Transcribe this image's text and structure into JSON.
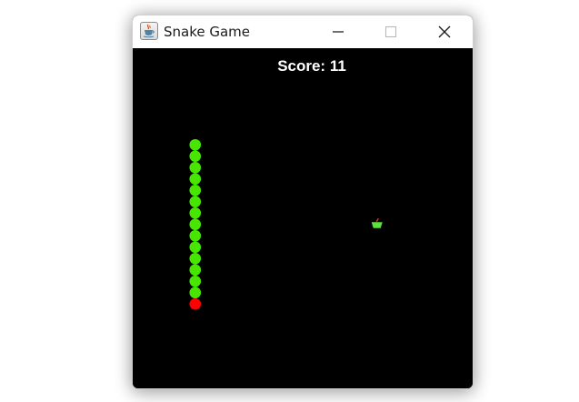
{
  "window": {
    "title": "Snake Game",
    "icon": "java-cup-icon",
    "controls": [
      "minimize-icon",
      "maximize-icon",
      "close-icon"
    ]
  },
  "game": {
    "score_text": "Score: 11",
    "colors": {
      "background": "#000000",
      "snake_body": "#46e600",
      "snake_head": "#ff0000",
      "apple": "#5ee23a",
      "apple_stem": "#d93b2b",
      "score": "#ffffff"
    },
    "snake": {
      "direction": "down",
      "segments": [
        {
          "col": 5,
          "row": 8
        },
        {
          "col": 5,
          "row": 9
        },
        {
          "col": 5,
          "row": 10
        },
        {
          "col": 5,
          "row": 11
        },
        {
          "col": 5,
          "row": 12
        },
        {
          "col": 5,
          "row": 13
        },
        {
          "col": 5,
          "row": 14
        },
        {
          "col": 5,
          "row": 15
        },
        {
          "col": 5,
          "row": 16
        },
        {
          "col": 5,
          "row": 17
        },
        {
          "col": 5,
          "row": 18
        },
        {
          "col": 5,
          "row": 19
        },
        {
          "col": 5,
          "row": 20
        },
        {
          "col": 5,
          "row": 21
        }
      ],
      "head": {
        "col": 5,
        "row": 22
      }
    },
    "apple": {
      "col": 21,
      "row": 15
    }
  }
}
